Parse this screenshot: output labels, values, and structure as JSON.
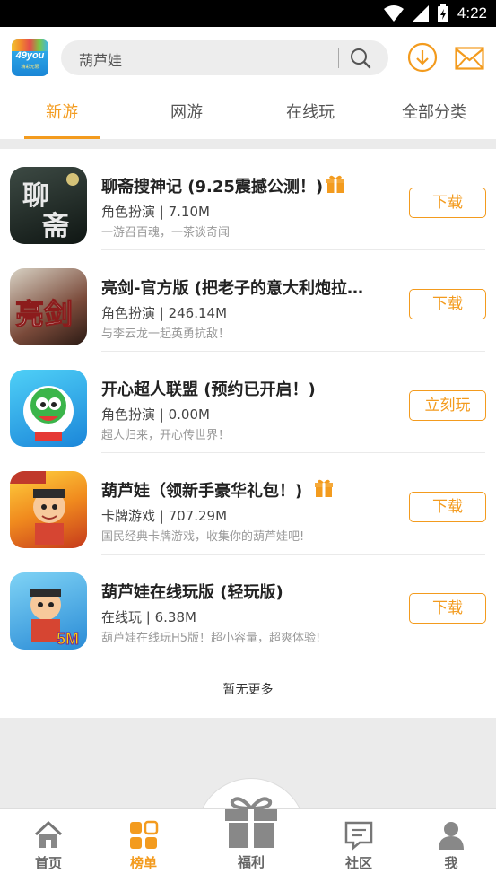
{
  "status_bar": {
    "time": "4:22"
  },
  "header": {
    "logo_text": "49you",
    "logo_subtext": "精彩无限",
    "search_placeholder": "葫芦娃"
  },
  "tabs": [
    {
      "label": "新游",
      "active": true
    },
    {
      "label": "网游",
      "active": false
    },
    {
      "label": "在线玩",
      "active": false
    },
    {
      "label": "全部分类",
      "active": false
    }
  ],
  "games": [
    {
      "title": "聊斋搜神记 (9.25震撼公测！)",
      "has_gift": true,
      "category": "角色扮演",
      "size": "7.10M",
      "meta": "角色扮演 | 7.10M",
      "description": "一游召百魂，一茶谈奇闻",
      "action": "下载",
      "icon_text": "聊斋"
    },
    {
      "title": "亮剑-官方版 (把老子的意大利炮拉…",
      "has_gift": false,
      "category": "角色扮演",
      "size": "246.14M",
      "meta": "角色扮演 | 246.14M",
      "description": "与李云龙一起英勇抗敌！",
      "action": "下载",
      "icon_text": "亮剑"
    },
    {
      "title": "开心超人联盟 (预约已开启！)",
      "has_gift": false,
      "category": "角色扮演",
      "size": "0.00M",
      "meta": "角色扮演 | 0.00M",
      "description": "超人归来，开心传世界！",
      "action": "立刻玩",
      "icon_text": ""
    },
    {
      "title": "葫芦娃（领新手豪华礼包！)",
      "has_gift": true,
      "category": "卡牌游戏",
      "size": "707.29M",
      "meta": "卡牌游戏 | 707.29M",
      "description": "国民经典卡牌游戏，收集你的葫芦娃吧!",
      "action": "下载",
      "icon_text": ""
    },
    {
      "title": "葫芦娃在线玩版 (轻玩版)",
      "has_gift": false,
      "category": "在线玩",
      "size": "6.38M",
      "meta": "在线玩 | 6.38M",
      "description": "葫芦娃在线玩H5版！超小容量，超爽体验!",
      "action": "下载",
      "icon_text": "5M"
    }
  ],
  "list_footer": "暂无更多",
  "bottom_nav": [
    {
      "label": "首页",
      "icon": "home-icon",
      "active": false
    },
    {
      "label": "榜单",
      "icon": "grid-icon",
      "active": true
    },
    {
      "label": "福利",
      "icon": "gift-icon",
      "active": false
    },
    {
      "label": "社区",
      "icon": "chat-icon",
      "active": false
    },
    {
      "label": "我",
      "icon": "user-icon",
      "active": false
    }
  ],
  "colors": {
    "accent": "#f39b1e",
    "background": "#ebebeb"
  }
}
